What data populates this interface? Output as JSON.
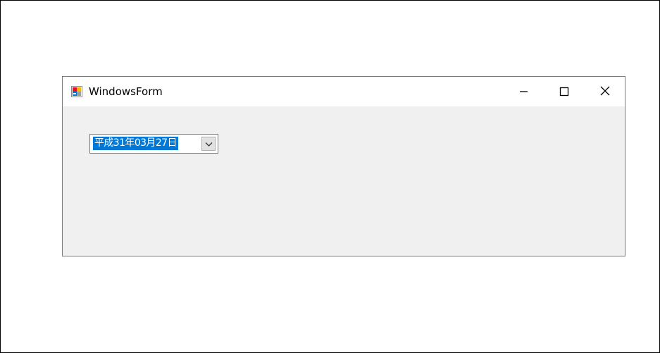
{
  "window": {
    "title": "WindowsForm",
    "icons": {
      "app": "windows-form-app-icon",
      "minimize": "minimize-icon",
      "maximize": "maximize-icon",
      "close": "close-icon"
    }
  },
  "date_picker": {
    "value": "平成31年03月27日",
    "dropdown_icon": "chevron-down-icon",
    "selected": true,
    "highlight_color": "#0078d7"
  },
  "colors": {
    "client_background": "#f0f0f0",
    "titlebar_background": "#ffffff"
  }
}
